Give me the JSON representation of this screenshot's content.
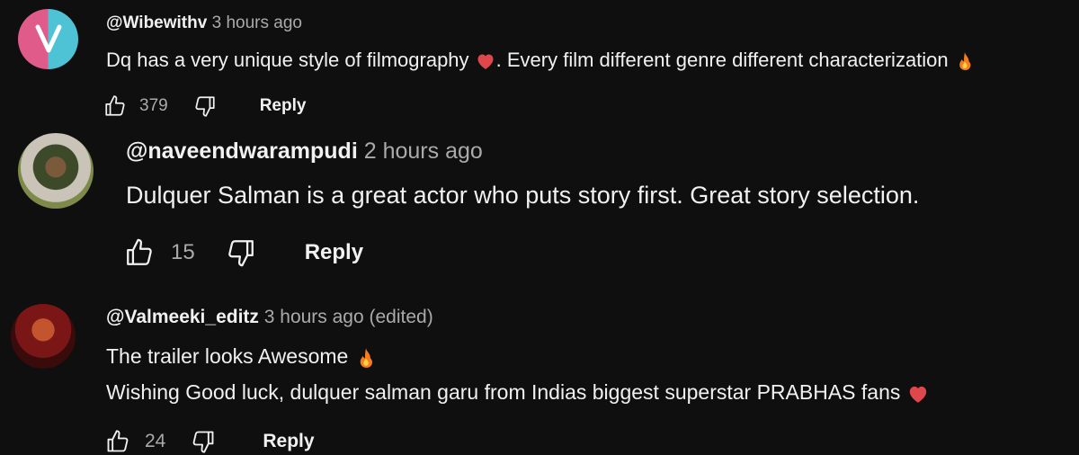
{
  "comments": [
    {
      "handle": "@Wibewithv",
      "time": "3 hours ago",
      "lines": [
        {
          "before": "Dq has a very unique style of filmography ",
          "emoji1": "heart",
          "after": ". Every film different genre different characterization ",
          "emoji2": "fire"
        }
      ],
      "likes": "379",
      "reply_label": "Reply",
      "avatar_color": "#4fc3d6",
      "avatar_accent": "#e05a8a"
    },
    {
      "handle": "@naveendwarampudi",
      "time": "2 hours ago",
      "text": "Dulquer Salman is a great actor who puts story first. Great story selection.",
      "likes": "15",
      "reply_label": "Reply",
      "avatar_color": "#5a6b3a"
    },
    {
      "handle": "@Valmeeki_editz",
      "time": "3 hours ago (edited)",
      "line1": "The trailer looks Awesome ",
      "line2": "Wishing Good luck, dulquer salman garu from Indias biggest superstar PRABHAS fans ",
      "likes": "24",
      "reply_label": "Reply",
      "avatar_color": "#8a1e1e"
    }
  ],
  "icons": {
    "like": "thumbs-up-icon",
    "dislike": "thumbs-down-icon",
    "heart": "red-heart-emoji",
    "fire": "fire-emoji"
  },
  "colors": {
    "background": "#0f0f0f",
    "text": "#f1f1f1",
    "secondary": "#aaaaaa",
    "heart": "#e0474c",
    "fire": "#f57c1f"
  }
}
